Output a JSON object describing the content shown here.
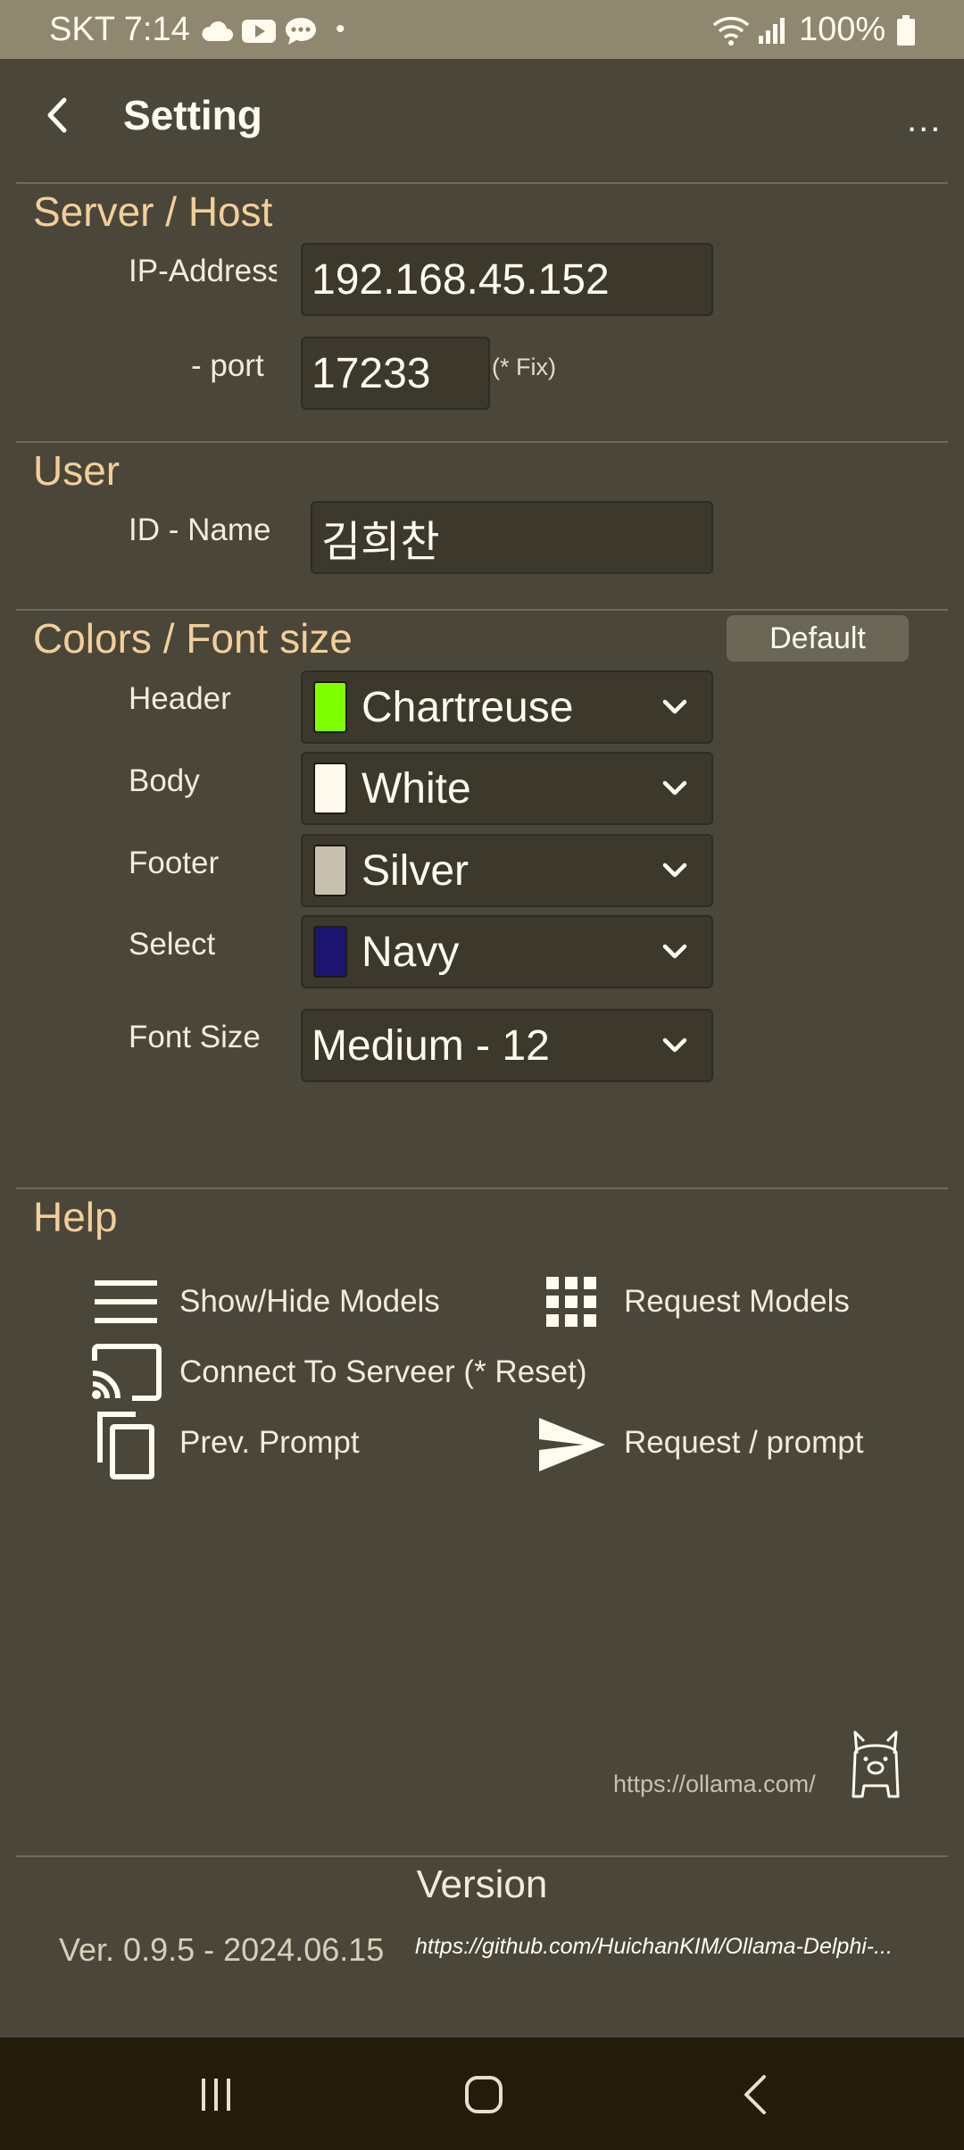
{
  "status_bar": {
    "carrier_time": "SKT 7:14",
    "dot": "•",
    "battery": "100%"
  },
  "app_bar": {
    "title": "Setting",
    "more": "..."
  },
  "server": {
    "section_title": "Server / Host",
    "ip_label": "IP-Address",
    "ip_value": "192.168.45.152",
    "port_label": "- port",
    "port_value": "17233",
    "port_note": "(* Fix)"
  },
  "user": {
    "section_title": "User",
    "id_label": "ID - Name",
    "id_value": "김희찬"
  },
  "colors": {
    "section_title": "Colors / Font size",
    "default_button": "Default",
    "rows": [
      {
        "label": "Header",
        "value": "Chartreuse",
        "swatch": "#7fff00"
      },
      {
        "label": "Body",
        "value": "White",
        "swatch": "#fff8ec"
      },
      {
        "label": "Footer",
        "value": "Silver",
        "swatch": "#c8c0ae"
      },
      {
        "label": "Select",
        "value": "Navy",
        "swatch": "#1c1670"
      }
    ],
    "font_label": "Font Size",
    "font_value": "Medium - 12"
  },
  "help": {
    "section_title": "Help",
    "show_hide_models": "Show/Hide Models",
    "request_models": "Request Models",
    "connect_to_server": "Connect To Serveer  (* Reset)",
    "prev_prompt": "Prev. Prompt",
    "request_prompt": "Request / prompt"
  },
  "ollama_link": "https://ollama.com/",
  "version": {
    "title": "Version",
    "value": "Ver. 0.9.5 - 2024.06.15",
    "github_link": "https://github.com/HuichanKIM/Ollama-Delphi-..."
  }
}
